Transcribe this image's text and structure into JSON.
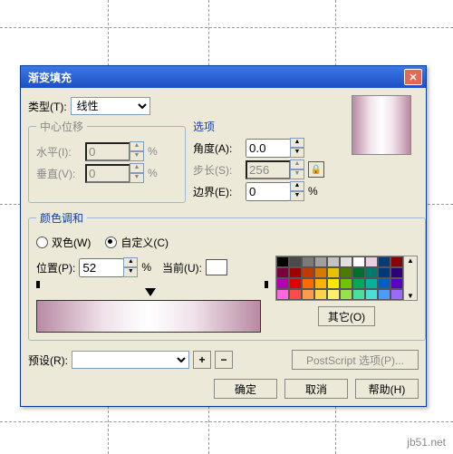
{
  "dialog": {
    "title": "渐变填充"
  },
  "type": {
    "label": "类型(T):",
    "value": "线性"
  },
  "center": {
    "legend": "中心位移",
    "h_label": "水平(I):",
    "h_value": "0",
    "v_label": "垂直(V):",
    "v_value": "0",
    "pct": "%"
  },
  "options": {
    "legend": "选项",
    "angle_label": "角度(A):",
    "angle_value": "0.0",
    "step_label": "步长(S):",
    "step_value": "256",
    "edge_label": "边界(E):",
    "edge_value": "0",
    "pct": "%"
  },
  "blend": {
    "legend": "颜色调和",
    "two_label": "双色(W)",
    "custom_label": "自定义(C)",
    "pos_label": "位置(P):",
    "pos_value": "52",
    "pct": "%",
    "current_label": "当前(U):"
  },
  "other_btn": "其它(O)",
  "preset": {
    "label": "预设(R):",
    "value": ""
  },
  "ps_btn": "PostScript 选项(P)...",
  "ok": "确定",
  "cancel": "取消",
  "help": "帮助(H)",
  "watermark": "jb51.net",
  "palette": [
    [
      "#030303",
      "#4a4a4a",
      "#7a7a7a",
      "#a0a0a0",
      "#c2c2c2",
      "#e0e0e0",
      "#ffffff",
      "#e9cfe0",
      "#0b3a6e",
      "#8b0000"
    ],
    [
      "#7a003c",
      "#a00000",
      "#c23a00",
      "#d97a00",
      "#e8c200",
      "#4f7a00",
      "#006e2e",
      "#007a6e",
      "#003a7a",
      "#2e007a"
    ],
    [
      "#b300b3",
      "#e00000",
      "#ff6a00",
      "#ffb300",
      "#ffe800",
      "#6fc400",
      "#00a85a",
      "#00b3a0",
      "#0060c4",
      "#5a00c4"
    ],
    [
      "#ff66e0",
      "#ff4a4a",
      "#ff9a4a",
      "#ffd24a",
      "#fff06a",
      "#9ae04a",
      "#4ae09a",
      "#4ae0d2",
      "#4a9aff",
      "#9a6aff"
    ]
  ]
}
